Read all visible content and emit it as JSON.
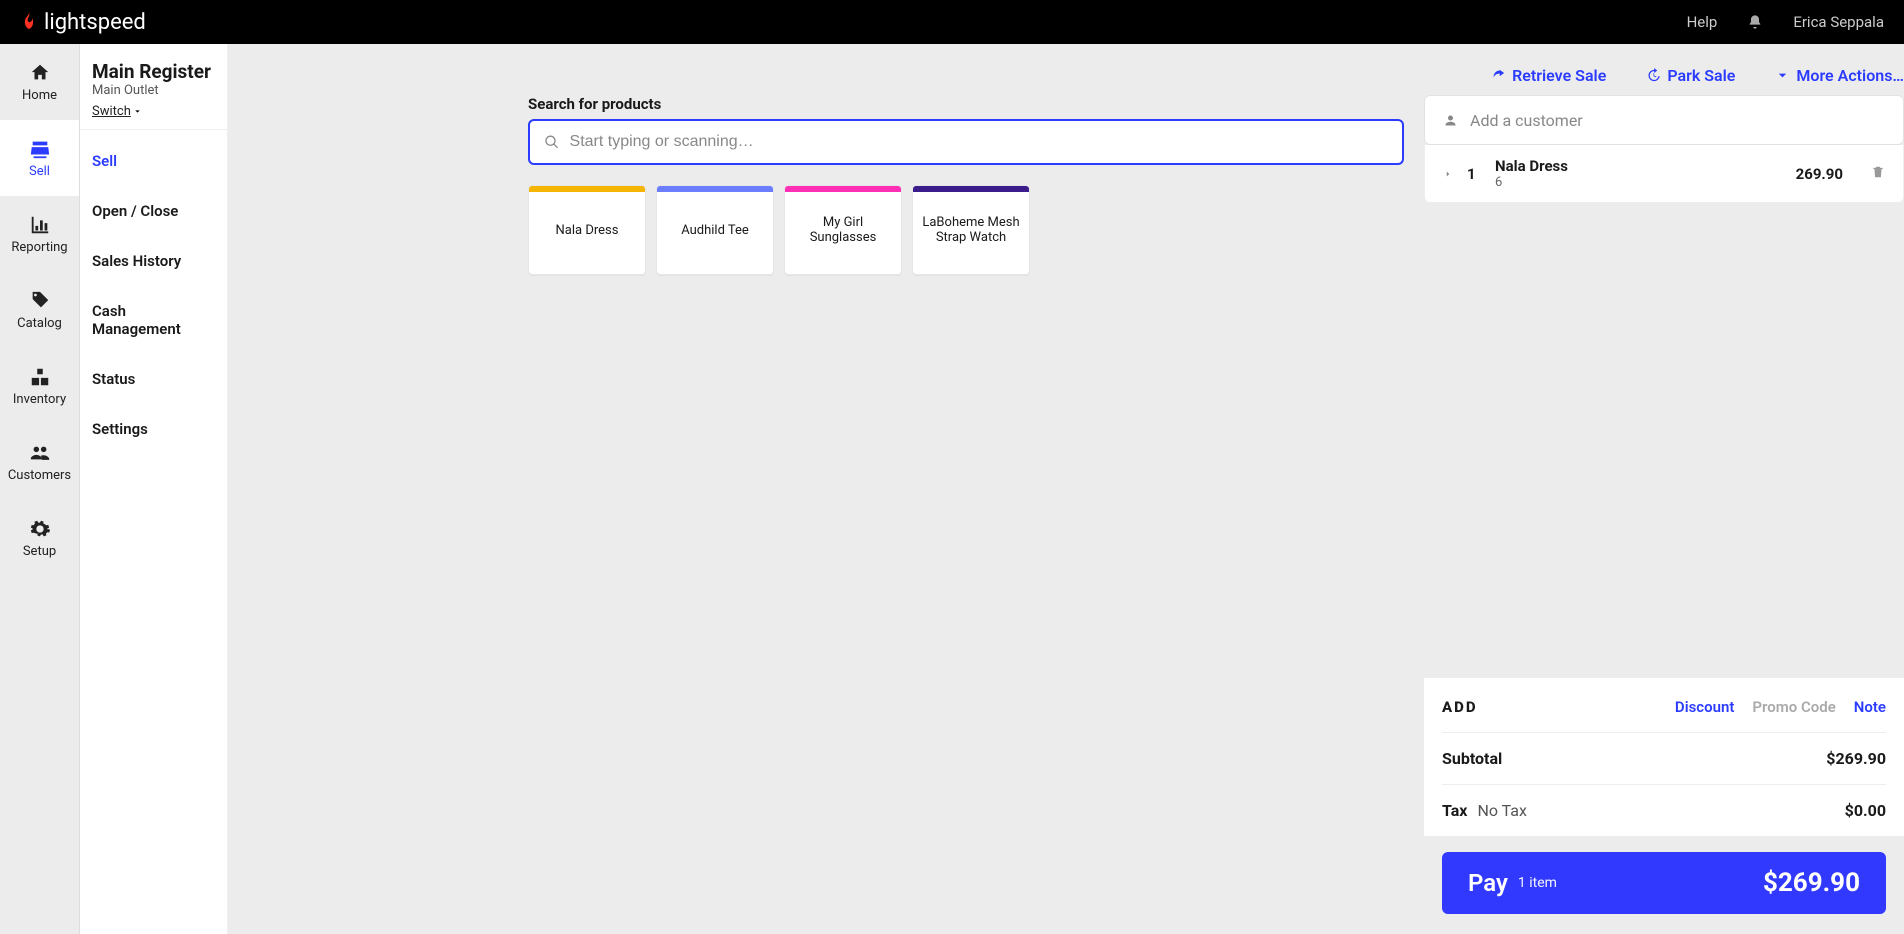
{
  "header": {
    "brand": "lightspeed",
    "help": "Help",
    "user": "Erica Seppala"
  },
  "rail": {
    "items": [
      {
        "key": "home",
        "label": "Home"
      },
      {
        "key": "sell",
        "label": "Sell"
      },
      {
        "key": "reporting",
        "label": "Reporting"
      },
      {
        "key": "catalog",
        "label": "Catalog"
      },
      {
        "key": "inventory",
        "label": "Inventory"
      },
      {
        "key": "customers",
        "label": "Customers"
      },
      {
        "key": "setup",
        "label": "Setup"
      }
    ],
    "active": "sell"
  },
  "register": {
    "title": "Main Register",
    "outlet": "Main Outlet",
    "switch": "Switch"
  },
  "subnav": {
    "items": [
      "Sell",
      "Open / Close",
      "Sales History",
      "Cash Management",
      "Status",
      "Settings"
    ],
    "active": "Sell"
  },
  "topActions": {
    "retrieve": "Retrieve Sale",
    "park": "Park Sale",
    "more": "More Actions…"
  },
  "search": {
    "label": "Search for products",
    "placeholder": "Start typing or scanning…"
  },
  "quickKeys": [
    {
      "label": "Nala Dress",
      "color": "c1"
    },
    {
      "label": "Audhild Tee",
      "color": "c2"
    },
    {
      "label": "My Girl Sunglasses",
      "color": "c3"
    },
    {
      "label": "LaBoheme Mesh Strap Watch",
      "color": "c4"
    }
  ],
  "customer": {
    "placeholder": "Add a customer"
  },
  "cart": {
    "items": [
      {
        "qty": "1",
        "name": "Nala Dress",
        "variant": "6",
        "price": "269.90"
      }
    ],
    "addLabel": "ADD",
    "links": {
      "discount": "Discount",
      "promo": "Promo Code",
      "note": "Note"
    },
    "subtotalLabel": "Subtotal",
    "subtotal": "$269.90",
    "taxLabel": "Tax",
    "taxName": "No Tax",
    "taxAmount": "$0.00",
    "payLabel": "Pay",
    "payCount": "1 item",
    "payAmount": "$269.90"
  }
}
